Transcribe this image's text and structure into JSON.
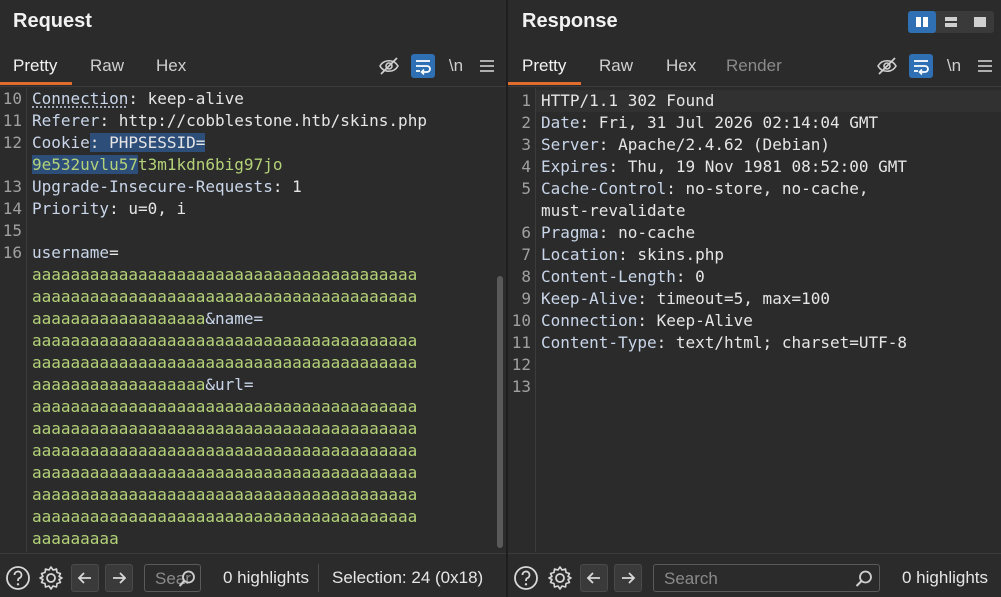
{
  "request": {
    "title": "Request",
    "tabs": [
      "Pretty",
      "Raw",
      "Hex"
    ],
    "lines": [
      {
        "n": "10",
        "parts": [
          {
            "t": "Connection",
            "c": "k u"
          },
          {
            "t": ": keep-alive",
            "c": "v"
          }
        ]
      },
      {
        "n": "11",
        "parts": [
          {
            "t": "Referer",
            "c": "k"
          },
          {
            "t": ": http://cobblestone.htb/skins.php",
            "c": "v"
          }
        ]
      },
      {
        "n": "12",
        "parts": [
          {
            "t": "Cookie",
            "c": "k"
          },
          {
            "t": ": PHPSESSID=",
            "c": "v sel"
          }
        ]
      },
      {
        "n": "",
        "parts": [
          {
            "t": "9e532uvlu57",
            "c": "g sel"
          },
          {
            "t": "t3m1kdn6big97jo",
            "c": "g"
          }
        ]
      },
      {
        "n": "13",
        "parts": [
          {
            "t": "Upgrade-Insecure-Requests",
            "c": "k"
          },
          {
            "t": ": 1",
            "c": "v"
          }
        ]
      },
      {
        "n": "14",
        "parts": [
          {
            "t": "Priority",
            "c": "k"
          },
          {
            "t": ": u=0, i",
            "c": "v"
          }
        ]
      },
      {
        "n": "15",
        "parts": []
      },
      {
        "n": "16",
        "parts": [
          {
            "t": "username",
            "c": "k"
          },
          {
            "t": "=",
            "c": "v"
          }
        ]
      },
      {
        "n": "",
        "parts": [
          {
            "t": "aaaaaaaaaaaaaaaaaaaaaaaaaaaaaaaaaaaaaaaa",
            "c": "g"
          }
        ]
      },
      {
        "n": "",
        "parts": [
          {
            "t": "aaaaaaaaaaaaaaaaaaaaaaaaaaaaaaaaaaaaaaaa",
            "c": "g"
          }
        ]
      },
      {
        "n": "",
        "parts": [
          {
            "t": "aaaaaaaaaaaaaaaaaa",
            "c": "g"
          },
          {
            "t": "&name=",
            "c": "k"
          }
        ]
      },
      {
        "n": "",
        "parts": [
          {
            "t": "aaaaaaaaaaaaaaaaaaaaaaaaaaaaaaaaaaaaaaaa",
            "c": "g"
          }
        ]
      },
      {
        "n": "",
        "parts": [
          {
            "t": "aaaaaaaaaaaaaaaaaaaaaaaaaaaaaaaaaaaaaaaa",
            "c": "g"
          }
        ]
      },
      {
        "n": "",
        "parts": [
          {
            "t": "aaaaaaaaaaaaaaaaaa",
            "c": "g"
          },
          {
            "t": "&url=",
            "c": "k"
          }
        ]
      },
      {
        "n": "",
        "parts": [
          {
            "t": "aaaaaaaaaaaaaaaaaaaaaaaaaaaaaaaaaaaaaaaa",
            "c": "g"
          }
        ]
      },
      {
        "n": "",
        "parts": [
          {
            "t": "aaaaaaaaaaaaaaaaaaaaaaaaaaaaaaaaaaaaaaaa",
            "c": "g"
          }
        ]
      },
      {
        "n": "",
        "parts": [
          {
            "t": "aaaaaaaaaaaaaaaaaaaaaaaaaaaaaaaaaaaaaaaa",
            "c": "g"
          }
        ]
      },
      {
        "n": "",
        "parts": [
          {
            "t": "aaaaaaaaaaaaaaaaaaaaaaaaaaaaaaaaaaaaaaaa",
            "c": "g"
          }
        ]
      },
      {
        "n": "",
        "parts": [
          {
            "t": "aaaaaaaaaaaaaaaaaaaaaaaaaaaaaaaaaaaaaaaa",
            "c": "g"
          }
        ]
      },
      {
        "n": "",
        "parts": [
          {
            "t": "aaaaaaaaaaaaaaaaaaaaaaaaaaaaaaaaaaaaaaaa",
            "c": "g"
          }
        ]
      },
      {
        "n": "",
        "parts": [
          {
            "t": "aaaaaaaaa",
            "c": "g"
          }
        ]
      }
    ],
    "search_placeholder": "Search",
    "highlights": "0 highlights",
    "selection": "Selection: 24 (0x18)"
  },
  "response": {
    "title": "Response",
    "tabs": [
      "Pretty",
      "Raw",
      "Hex",
      "Render"
    ],
    "lines": [
      {
        "n": "1",
        "parts": [
          {
            "t": "HTTP/1.1 302 Found",
            "c": "v"
          }
        ]
      },
      {
        "n": "2",
        "parts": [
          {
            "t": "Date",
            "c": "k"
          },
          {
            "t": ": Fri, 31 Jul 2026 02:14:04 GMT",
            "c": "v"
          }
        ]
      },
      {
        "n": "3",
        "parts": [
          {
            "t": "Server",
            "c": "k"
          },
          {
            "t": ": Apache/2.4.62 (Debian)",
            "c": "v"
          }
        ]
      },
      {
        "n": "4",
        "parts": [
          {
            "t": "Expires",
            "c": "k"
          },
          {
            "t": ": Thu, 19 Nov 1981 08:52:00 GMT",
            "c": "v"
          }
        ]
      },
      {
        "n": "5",
        "parts": [
          {
            "t": "Cache-Control",
            "c": "k"
          },
          {
            "t": ": no-store, no-cache,",
            "c": "v"
          }
        ]
      },
      {
        "n": "",
        "parts": [
          {
            "t": "must-revalidate",
            "c": "v"
          }
        ]
      },
      {
        "n": "6",
        "parts": [
          {
            "t": "Pragma",
            "c": "k"
          },
          {
            "t": ": no-cache",
            "c": "v"
          }
        ]
      },
      {
        "n": "7",
        "parts": [
          {
            "t": "Location",
            "c": "k"
          },
          {
            "t": ": skins.php",
            "c": "v"
          }
        ]
      },
      {
        "n": "8",
        "parts": [
          {
            "t": "Content-Length",
            "c": "k"
          },
          {
            "t": ": 0",
            "c": "v"
          }
        ]
      },
      {
        "n": "9",
        "parts": [
          {
            "t": "Keep-Alive",
            "c": "k"
          },
          {
            "t": ": timeout=5, max=100",
            "c": "v"
          }
        ]
      },
      {
        "n": "10",
        "parts": [
          {
            "t": "Connection",
            "c": "k"
          },
          {
            "t": ": Keep-Alive",
            "c": "v"
          }
        ]
      },
      {
        "n": "11",
        "parts": [
          {
            "t": "Content-Type",
            "c": "k"
          },
          {
            "t": ": text/html; charset=UTF-8",
            "c": "v"
          }
        ]
      },
      {
        "n": "12",
        "parts": []
      },
      {
        "n": "13",
        "parts": []
      }
    ],
    "search_placeholder": "Search",
    "highlights": "0 highlights"
  },
  "toolbar": {
    "newline_label": "\\n"
  },
  "colors": {
    "accent": "#e06c2d",
    "toggle_on": "#2f6fb3",
    "key": "#c9d6ea",
    "param_value": "#b4d278",
    "selection": "#2e4e7a"
  }
}
